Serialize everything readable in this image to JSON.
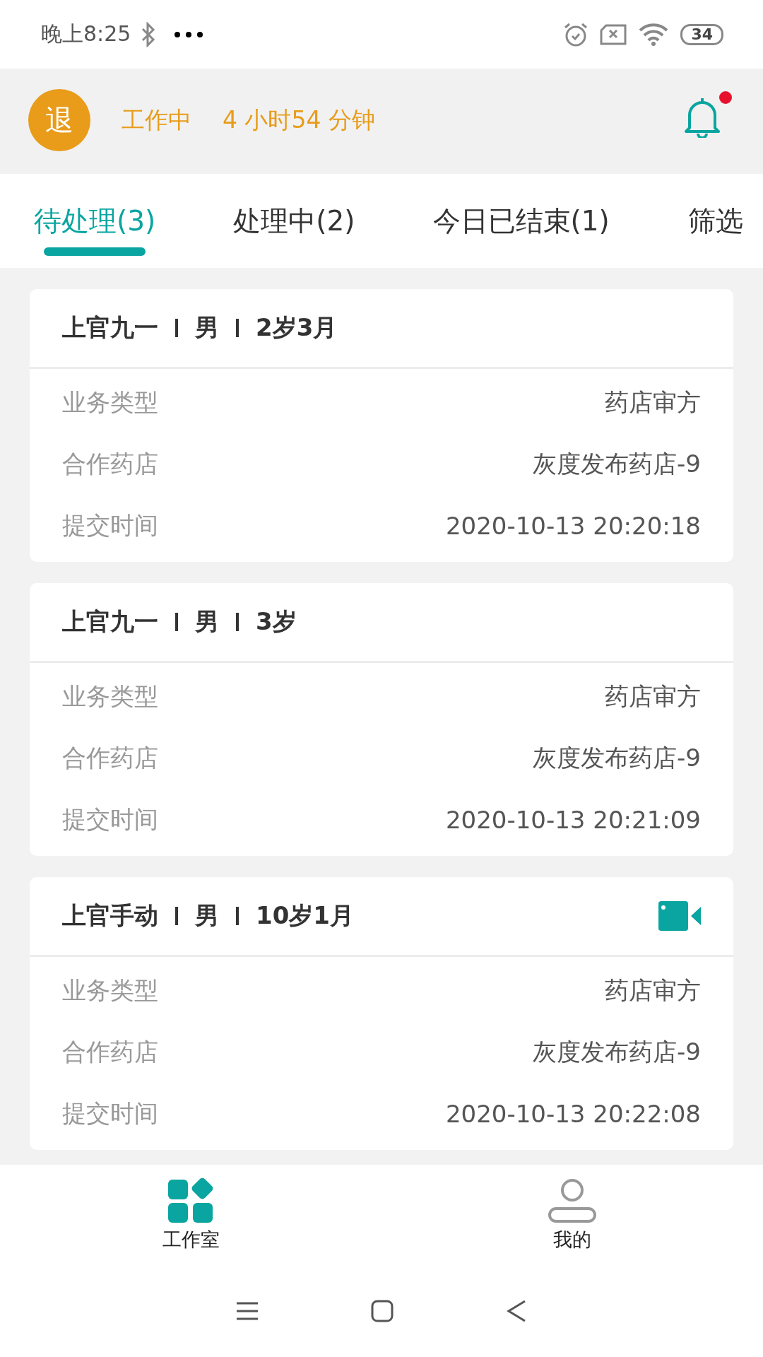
{
  "status_bar": {
    "time": "晚上8:25",
    "battery": "34"
  },
  "header": {
    "exit_badge": "退",
    "status": "工作中",
    "duration": "4 小时54 分钟",
    "has_unread": true
  },
  "tabs": [
    {
      "label": "待处理(3)",
      "selected": true
    },
    {
      "label": "处理中(2)",
      "selected": false
    },
    {
      "label": "今日已结束(1)",
      "selected": false
    }
  ],
  "filter": "筛选",
  "cards": [
    {
      "name": "上官九一",
      "gender": "男",
      "age": "2岁3月",
      "video": false,
      "rows": [
        {
          "label": "业务类型",
          "value": "药店审方"
        },
        {
          "label": "合作药店",
          "value": "灰度发布药店-9"
        },
        {
          "label": "提交时间",
          "value": "2020-10-13 20:20:18"
        }
      ]
    },
    {
      "name": "上官九一",
      "gender": "男",
      "age": "3岁",
      "video": false,
      "rows": [
        {
          "label": "业务类型",
          "value": "药店审方"
        },
        {
          "label": "合作药店",
          "value": "灰度发布药店-9"
        },
        {
          "label": "提交时间",
          "value": "2020-10-13 20:21:09"
        }
      ]
    },
    {
      "name": "上官手动",
      "gender": "男",
      "age": "10岁1月",
      "video": true,
      "rows": [
        {
          "label": "业务类型",
          "value": "药店审方"
        },
        {
          "label": "合作药店",
          "value": "灰度发布药店-9"
        },
        {
          "label": "提交时间",
          "value": "2020-10-13 20:22:08"
        }
      ]
    }
  ],
  "bottom_nav": [
    {
      "label": "工作室",
      "kind": "grid",
      "selected": true
    },
    {
      "label": "我的",
      "kind": "person",
      "selected": false
    }
  ]
}
